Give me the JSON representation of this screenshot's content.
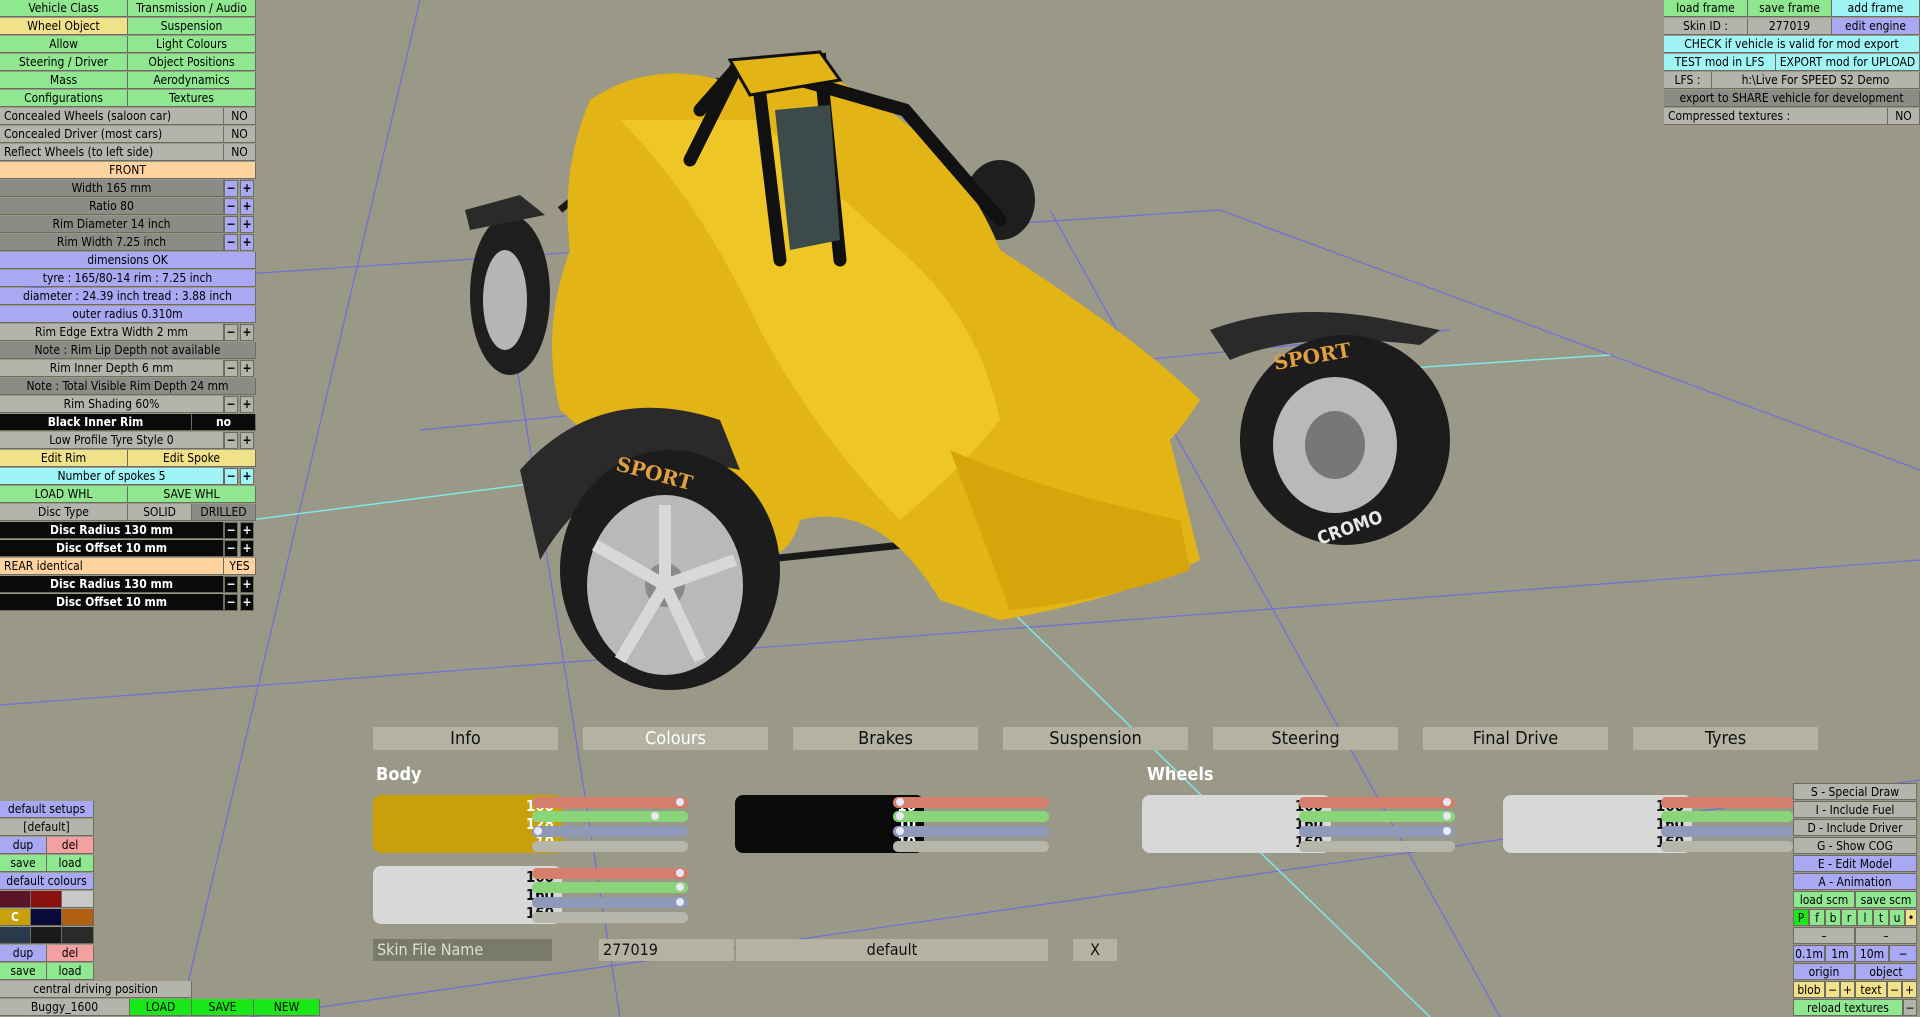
{
  "left_panel": {
    "tabs": [
      [
        "Vehicle Class",
        "Transmission / Audio"
      ],
      [
        "Wheel Object",
        "Suspension"
      ],
      [
        "Allow",
        "Light Colours"
      ],
      [
        "Steering / Driver",
        "Object Positions"
      ],
      [
        "Mass",
        "Aerodynamics"
      ],
      [
        "Configurations",
        "Textures"
      ]
    ],
    "concealed_wheels_label": "Concealed Wheels (saloon car)",
    "concealed_wheels_value": "NO",
    "concealed_driver_label": "Concealed Driver (most cars)",
    "concealed_driver_value": "NO",
    "reflect_wheels_label": "Reflect Wheels (to left side)",
    "reflect_wheels_value": "NO",
    "front_label": "FRONT",
    "width": "Width 165 mm",
    "ratio": "Ratio 80",
    "rim_diameter": "Rim Diameter 14 inch",
    "rim_width": "Rim Width 7.25 inch",
    "dimensions_ok": "dimensions OK",
    "tyre_info": "tyre : 165/80-14   rim : 7.25 inch",
    "diameter_info": "diameter : 24.39 inch   tread : 3.88 inch",
    "outer_radius": "outer radius 0.310m",
    "rim_edge": "Rim Edge Extra Width 2 mm",
    "note_lip": "Note : Rim Lip Depth not available",
    "rim_inner": "Rim Inner Depth 6 mm",
    "note_total": "Note : Total Visible Rim Depth 24 mm",
    "rim_shading": "Rim Shading 60%",
    "black_inner_rim": "Black Inner Rim",
    "black_inner_rim_value": "no",
    "low_profile": "Low Profile Tyre Style 0",
    "edit_rim": "Edit Rim",
    "edit_spoke": "Edit Spoke",
    "spokes": "Number of spokes 5",
    "load_whl": "LOAD WHL",
    "save_whl": "SAVE WHL",
    "disc_type": "Disc Type",
    "solid": "SOLID",
    "drilled": "DRILLED",
    "disc_radius_front": "Disc Radius 130 mm",
    "disc_offset_front": "Disc Offset 10 mm",
    "rear_identical": "REAR identical",
    "rear_identical_value": "YES",
    "disc_radius_rear": "Disc Radius 130 mm",
    "disc_offset_rear": "Disc Offset 10 mm",
    "minus": "−",
    "plus": "+"
  },
  "bottom_left": {
    "default_setups": "default setups",
    "default_item": "[default]",
    "dup": "dup",
    "del": "del",
    "save": "save",
    "load": "load",
    "default_colours": "default colours",
    "c_label": "C",
    "central_driving": "central driving position",
    "car_name": "Buggy_1600",
    "load_btn": "LOAD",
    "save_btn": "SAVE",
    "new_btn": "NEW"
  },
  "top_right": {
    "load_frame": "load frame",
    "save_frame": "save frame",
    "add_frame": "add frame",
    "skin_id_label": "Skin ID :",
    "skin_id_value": "277019",
    "edit_engine": "edit engine",
    "check_valid": "CHECK if vehicle is valid for mod export",
    "test_mod": "TEST mod in LFS",
    "export_mod": "EXPORT mod for UPLOAD",
    "lfs_label": "LFS :",
    "lfs_path": "h:\\Live For SPEED S2 Demo",
    "export_share": "export to SHARE vehicle for development",
    "compressed_label": "Compressed textures :",
    "compressed_value": "NO"
  },
  "bottom_tabs": [
    "Info",
    "Colours",
    "Brakes",
    "Suspension",
    "Steering",
    "Final Drive",
    "Tyres"
  ],
  "colours": {
    "body_label": "Body",
    "wheels_label": "Wheels",
    "body_primary": {
      "values": [
        "160",
        "128",
        "10"
      ],
      "color": "#c8a00a"
    },
    "body_secondary": {
      "values": [
        "10",
        "10",
        "10"
      ],
      "color": "#0a0a0a"
    },
    "body_third": {
      "values": [
        "160",
        "160",
        "160"
      ],
      "color": "#d8d8d8"
    },
    "wheels_primary": {
      "values": [
        "160",
        "160",
        "160"
      ],
      "color": "#d8d8d8"
    },
    "wheels_secondary": {
      "values": [
        "160",
        "160",
        "160"
      ],
      "color": "#d8d8d8"
    },
    "skin_file_label": "Skin File Name",
    "skin_file_id": "277019",
    "skin_file_value": "default",
    "close": "X"
  },
  "right_tools": {
    "special_draw": "S - Special Draw",
    "include_fuel": "I - Include Fuel",
    "include_driver": "D - Include Driver",
    "show_cog": "G - Show COG",
    "edit_model": "E - Edit Model",
    "animation": "A - Animation",
    "load_scm": "load scm",
    "save_scm": "save scm",
    "view_letters": [
      "P",
      "f",
      "b",
      "r",
      "l",
      "t",
      "u"
    ],
    "dash1": "–",
    "dash2": "–",
    "scale_01": "0.1m",
    "scale_1": "1m",
    "scale_10": "10m",
    "scale_minus": "−",
    "origin": "origin",
    "object": "object",
    "blob": "blob",
    "text": "text",
    "minus": "−",
    "plus": "+",
    "reload_textures": "reload textures"
  }
}
